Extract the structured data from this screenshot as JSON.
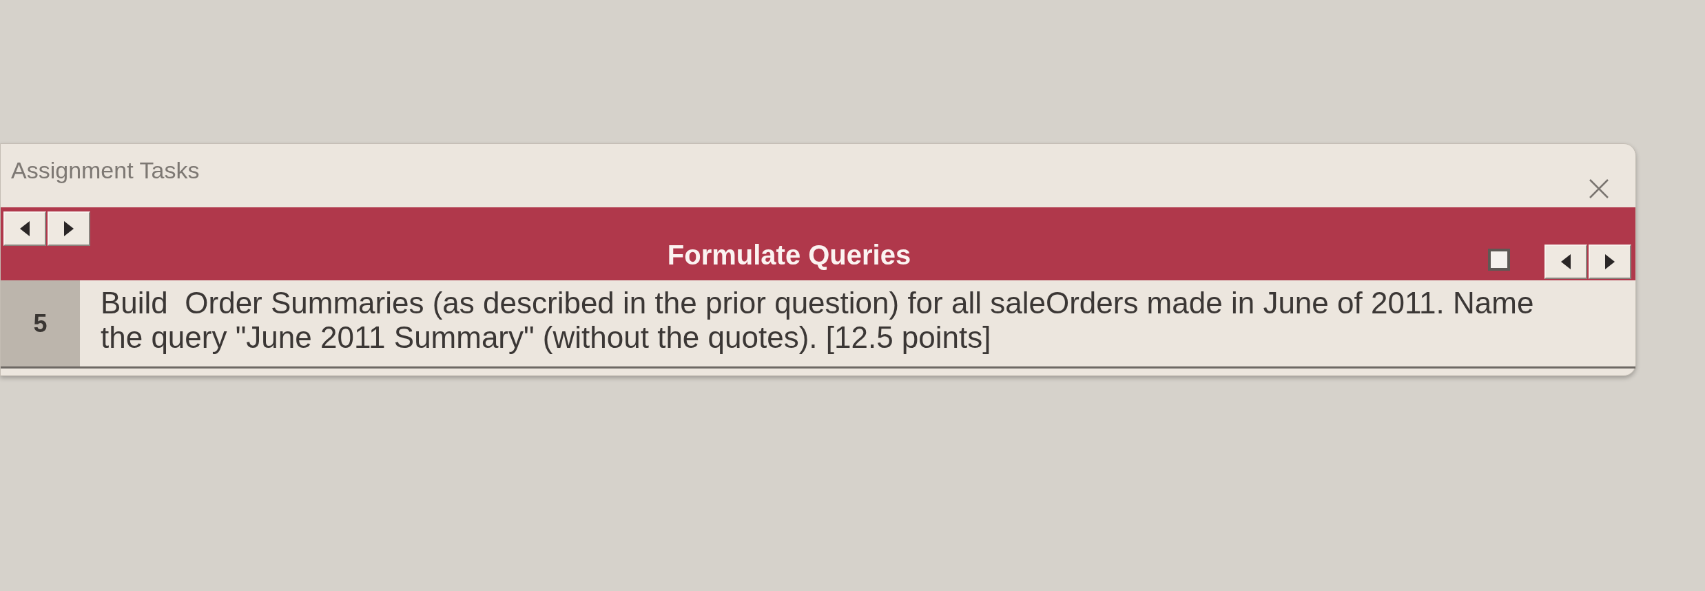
{
  "panel": {
    "title": "Assignment Tasks"
  },
  "header": {
    "title": "Formulate Queries",
    "checkbox": {
      "checked": false
    }
  },
  "tasks": [
    {
      "number": "5",
      "text": "Build  Order Summaries (as described in the prior question) for all saleOrders made in June of 2011. Name the query \"June 2011 Summary\" (without the quotes). [12.5 points]"
    }
  ]
}
